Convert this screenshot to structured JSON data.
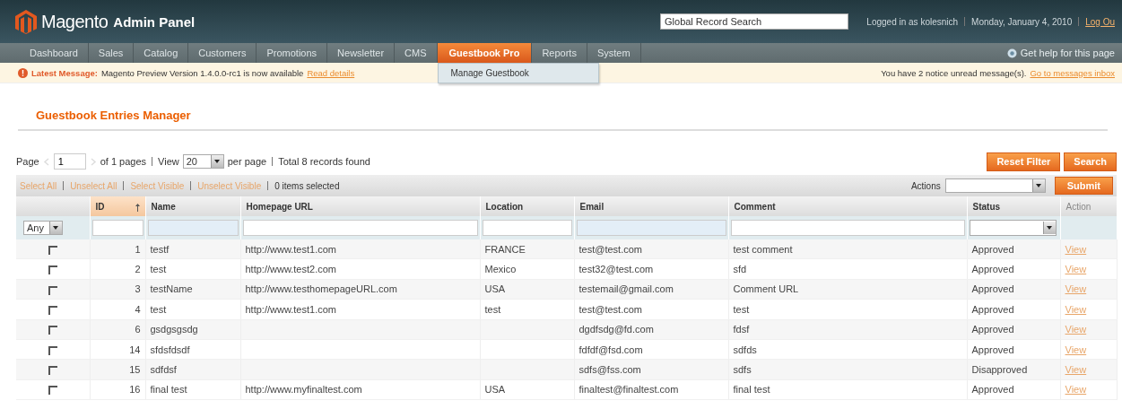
{
  "header": {
    "logo_brand": "Magento",
    "logo_suffix": "Admin Panel",
    "search": {
      "placeholder": "Global Record Search"
    },
    "user_links": [
      {
        "text": "Logged in as kolesnich",
        "kind": "text"
      },
      {
        "text": "Monday, January 4, 2010",
        "kind": "text"
      },
      {
        "text": "Log Ou",
        "kind": "link"
      }
    ]
  },
  "nav": {
    "items": [
      {
        "label": "Dashboard",
        "selected": false
      },
      {
        "label": "Sales",
        "selected": false
      },
      {
        "label": "Catalog",
        "selected": false
      },
      {
        "label": "Customers",
        "selected": false
      },
      {
        "label": "Promotions",
        "selected": false
      },
      {
        "label": "Newsletter",
        "selected": false
      },
      {
        "label": "CMS",
        "selected": false
      },
      {
        "label": "Guestbook Pro",
        "selected": true,
        "submenu": [
          "Manage Guestbook"
        ]
      },
      {
        "label": "Reports",
        "selected": false
      },
      {
        "label": "System",
        "selected": false
      }
    ],
    "help": "Get help for this page"
  },
  "message_bar": {
    "label": "Latest Message:",
    "text": "Magento Preview Version 1.4.0.0-rc1 is now available",
    "link": "Read details",
    "notice": "You have 2 notice unread message(s).",
    "notice_link": "Go to messages inbox"
  },
  "page_title": "Guestbook Entries Manager",
  "pager": {
    "page_label": "Page",
    "page": "1",
    "of_pages": "of 1 pages",
    "view_label": "View",
    "per_page": "20",
    "per_page_label": "per page",
    "total": "Total 8 records found"
  },
  "buttons": [
    "Reset Filter",
    "Search"
  ],
  "massaction": {
    "links": [
      "Select All",
      "Unselect All",
      "Select Visible",
      "Unselect Visible"
    ],
    "count": "0 items selected",
    "actions_label": "Actions",
    "submit": "Submit"
  },
  "table": {
    "columns": [
      {
        "sorted": false
      },
      {
        "label": "ID",
        "sorted": true
      },
      {
        "label": "Name",
        "sorted": false
      },
      {
        "label": "Homepage URL",
        "sorted": false
      },
      {
        "label": "Location",
        "sorted": false
      },
      {
        "label": "Email",
        "sorted": false
      },
      {
        "label": "Comment",
        "sorted": false
      },
      {
        "label": "Status",
        "sorted": false
      },
      {
        "label": "Action",
        "sorted": false
      }
    ],
    "filter_any": "Any",
    "rows": [
      {
        "checked": false,
        "id": "1",
        "name": "testf",
        "url": "http://www.test1.com",
        "location": "FRANCE",
        "email": "test@test.com",
        "comment": "test comment",
        "status": "Approved",
        "action": "View"
      },
      {
        "checked": false,
        "id": "2",
        "name": "test",
        "url": "http://www.test2.com",
        "location": "Mexico",
        "email": "test32@test.com",
        "comment": "sfd",
        "status": "Approved",
        "action": "View"
      },
      {
        "checked": false,
        "id": "3",
        "name": "testName",
        "url": "http://www.testhomepageURL.com",
        "location": "USA",
        "email": "testemail@gmail.com",
        "comment": "Comment URL",
        "status": "Approved",
        "action": "View"
      },
      {
        "checked": false,
        "id": "4",
        "name": "test",
        "url": "http://www.test1.com",
        "location": "test",
        "email": "test@test.com",
        "comment": "test",
        "status": "Approved",
        "action": "View"
      },
      {
        "checked": false,
        "id": "6",
        "name": "gsdgsgsdg",
        "email": "dgdfsdg@fd.com",
        "comment": "fdsf",
        "status": "Approved",
        "action": "View"
      },
      {
        "checked": false,
        "id": "14",
        "name": "sfdsfdsdf",
        "email": "fdfdf@fsd.com",
        "comment": "sdfds",
        "status": "Approved",
        "action": "View"
      },
      {
        "checked": false,
        "id": "15",
        "name": "sdfdsf",
        "email": "sdfs@fss.com",
        "comment": "sdfs",
        "status": "Disapproved",
        "action": "View"
      },
      {
        "checked": false,
        "id": "16",
        "name": "final test",
        "url": "http://www.myfinaltest.com",
        "location": "USA",
        "email": "finaltest@finaltest.com",
        "comment": "final test",
        "status": "Approved",
        "action": "View"
      }
    ]
  }
}
